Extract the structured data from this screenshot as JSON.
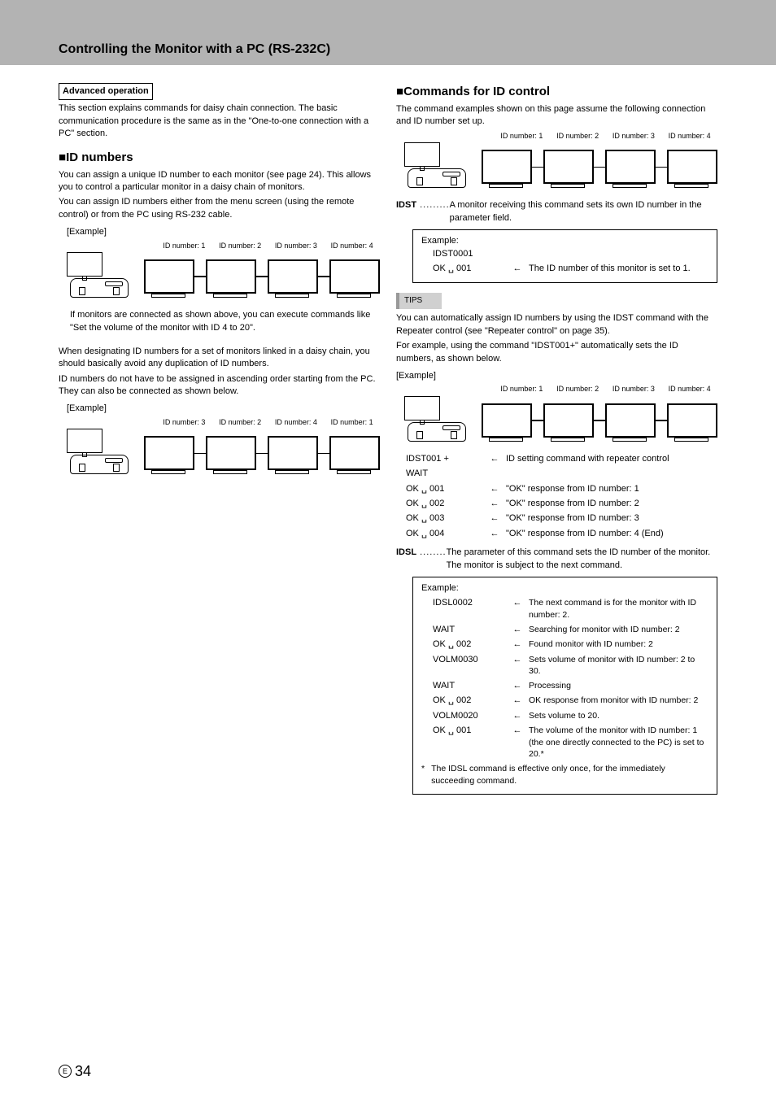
{
  "header": {
    "title": "Controlling the Monitor with a PC (RS-232C)"
  },
  "left": {
    "adv_box": "Advanced operation",
    "adv_p1": "This section explains commands for daisy chain connection. The basic communication procedure is the same as in the \"One-to-one connection with a PC\" section.",
    "sec_id_title": "ID numbers",
    "id_p1": "You can assign a unique ID number to each monitor (see page 24). This allows you to control a particular monitor in a daisy chain of monitors.",
    "id_p2": "You can assign ID numbers either from the menu screen (using the remote control) or from the PC using RS-232 cable.",
    "example_label": "[Example]",
    "labels1": [
      "ID number: 1",
      "ID number: 2",
      "ID number: 3",
      "ID number: 4"
    ],
    "id_p3": "If monitors are connected as shown above, you can execute commands like \"Set the volume of the monitor with ID 4 to 20\".",
    "id_p4": "When designating ID numbers for a set of monitors linked in a daisy chain, you should basically avoid any duplication of ID numbers.",
    "id_p5": "ID numbers do not have to be assigned in ascending order starting from the PC. They can also be connected as shown below.",
    "labels2": [
      "ID number: 3",
      "ID number: 2",
      "ID number: 4",
      "ID number: 1"
    ]
  },
  "right": {
    "sec_cmd_title": "Commands for ID control",
    "cmd_p1": "The command examples shown on this page assume the following connection and ID number set up.",
    "labels3": [
      "ID number: 1",
      "ID number: 2",
      "ID number: 3",
      "ID number: 4"
    ],
    "idst_term": "IDST",
    "idst_body": "A monitor receiving this command sets its own ID number in the parameter field.",
    "idst_example": {
      "title": "Example:",
      "cmd": "IDST0001",
      "resp_left": "OK ␣ 001",
      "resp_right": "The ID number of this monitor is set to 1."
    },
    "tips_label": "TIPS",
    "tips_p1": "You can automatically assign ID numbers by using the IDST command with the Repeater control (see \"Repeater control\" on page 35).",
    "tips_p2": "For example, using the command \"IDST001+\" automatically sets the ID numbers, as shown below.",
    "labels4": [
      "ID number: 1",
      "ID number: 2",
      "ID number: 3",
      "ID number: 4"
    ],
    "rep_lines": [
      {
        "l": "IDST001 +",
        "r": "ID setting command with repeater control"
      },
      {
        "l": "WAIT",
        "r": ""
      },
      {
        "l": "OK ␣ 001",
        "r": "\"OK\" response from ID number: 1"
      },
      {
        "l": "OK ␣ 002",
        "r": "\"OK\" response from ID number: 2"
      },
      {
        "l": "OK ␣ 003",
        "r": "\"OK\" response from ID number: 3"
      },
      {
        "l": "OK ␣ 004",
        "r": "\"OK\" response from ID number: 4 (End)"
      }
    ],
    "idsl_term": "IDSL",
    "idsl_body": "The parameter of this command sets the ID number of the monitor. The monitor is subject to the next command.",
    "idsl_example": {
      "title": "Example:",
      "rows": [
        {
          "l": "IDSL0002",
          "r": "The next command is for the monitor with ID number: 2."
        },
        {
          "l": "WAIT",
          "r": "Searching for monitor with ID number: 2"
        },
        {
          "l": "OK ␣ 002",
          "r": "Found monitor with ID number: 2"
        },
        {
          "l": "VOLM0030",
          "r": "Sets volume of monitor with ID number: 2 to 30."
        },
        {
          "l": "WAIT",
          "r": "Processing"
        },
        {
          "l": "OK ␣ 002",
          "r": "OK response from monitor with ID number: 2"
        },
        {
          "l": "VOLM0020",
          "r": "Sets volume to 20."
        },
        {
          "l": "OK ␣ 001",
          "r": "The volume of the monitor with ID number: 1 (the one directly connected to the PC) is set to 20.*"
        }
      ],
      "note": "The IDSL command is effective only once, for the immediately succeeding command."
    }
  },
  "footer": {
    "page": "34",
    "lang": "E"
  }
}
